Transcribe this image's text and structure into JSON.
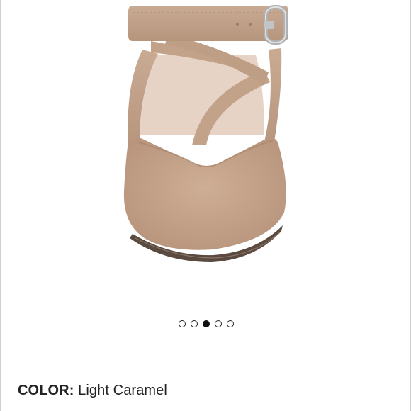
{
  "carousel": {
    "image_alt": "Light caramel suede pointed flat with ankle strap, front view",
    "slide_count": 5,
    "active_index": 2
  },
  "product": {
    "color_label": "COLOR:",
    "color_value": "Light Caramel"
  },
  "colors": {
    "suede": "#c8a78e",
    "suede_shadow": "#ad8b72",
    "lining": "#e6cfc3",
    "buckle": "#bfc0c3",
    "text": "#222222"
  }
}
